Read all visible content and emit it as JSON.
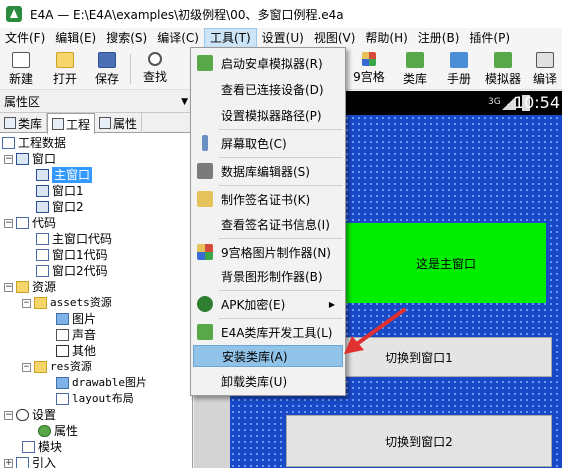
{
  "window": {
    "title": "E4A — E:\\E4A\\examples\\初级例程\\00、多窗口例程.e4a"
  },
  "menubar": [
    {
      "label": "文件(F)"
    },
    {
      "label": "编辑(E)"
    },
    {
      "label": "搜索(S)"
    },
    {
      "label": "编译(C)"
    },
    {
      "label": "工具(T)",
      "active": true
    },
    {
      "label": "设置(U)"
    },
    {
      "label": "视图(V)"
    },
    {
      "label": "帮助(H)"
    },
    {
      "label": "注册(B)"
    },
    {
      "label": "插件(P)"
    }
  ],
  "toolbar": {
    "new_label": "新建",
    "open_label": "打开",
    "save_label": "保存",
    "find_label": "查找",
    "grid9_label": "9宫格",
    "lib_label": "类库",
    "manual_label": "手册",
    "emulator_label": "模拟器",
    "compile_label": "编译"
  },
  "left_panel": {
    "header": "属性区",
    "tabs": [
      "类库",
      "工程",
      "属性"
    ],
    "tree": {
      "project_data": "工程数据",
      "window": "窗口",
      "main_window": "主窗口",
      "window1": "窗口1",
      "window2": "窗口2",
      "code": "代码",
      "main_window_code": "主窗口代码",
      "window1_code": "窗口1代码",
      "window2_code": "窗口2代码",
      "resources": "资源",
      "assets_resources": "assets资源",
      "images": "图片",
      "sounds": "声音",
      "other": "其他",
      "res_resources": "res资源",
      "drawable_images": "drawable图片",
      "layout": "layout布局",
      "settings": "设置",
      "properties": "属性",
      "modules": "模块",
      "imports": "引入"
    }
  },
  "phone": {
    "signal_label": "3G",
    "time": "10:54",
    "green_label": "这是主窗口",
    "button1": "切换到窗口1",
    "button2": "切换到窗口2"
  },
  "tools_menu": [
    {
      "label": "启动安卓模拟器(R)",
      "icon": "emulator-icon",
      "color": "#58a84a"
    },
    {
      "label": "查看已连接设备(D)",
      "icon": "",
      "color": ""
    },
    {
      "label": "设置模拟器路径(P)",
      "icon": "",
      "color": ""
    },
    {
      "label": "屏幕取色(C)",
      "icon": "eyedropper-icon",
      "color": "#6a8fc2"
    },
    {
      "label": "数据库编辑器(S)",
      "icon": "database-icon",
      "color": "#7a7a7a"
    },
    {
      "label": "制作签名证书(K)",
      "icon": "certificate-icon",
      "color": "#e6c25a"
    },
    {
      "label": "查看签名证书信息(I)",
      "icon": "",
      "color": ""
    },
    {
      "label": "9宫格图片制作器(N)",
      "icon": "grid-icon",
      "color": "#d64a3a"
    },
    {
      "label": "背景图形制作器(B)",
      "icon": "",
      "color": ""
    },
    {
      "label": "APK加密(E)",
      "icon": "shield-icon",
      "color": "#2f7d2f",
      "submenu": true
    },
    {
      "label": "E4A类库开发工具(L)",
      "icon": "library-tool-icon",
      "color": "#58a84a"
    },
    {
      "label": "安装类库(A)",
      "icon": "",
      "color": "",
      "highlighted": true
    },
    {
      "label": "卸载类库(U)",
      "icon": "",
      "color": ""
    }
  ],
  "colors": {
    "selection": "#3399ff",
    "menu_highlight": "#91c2e8",
    "phone_bg": "#1a49c8",
    "green_box": "#00ee00",
    "arrow": "#e03030"
  }
}
